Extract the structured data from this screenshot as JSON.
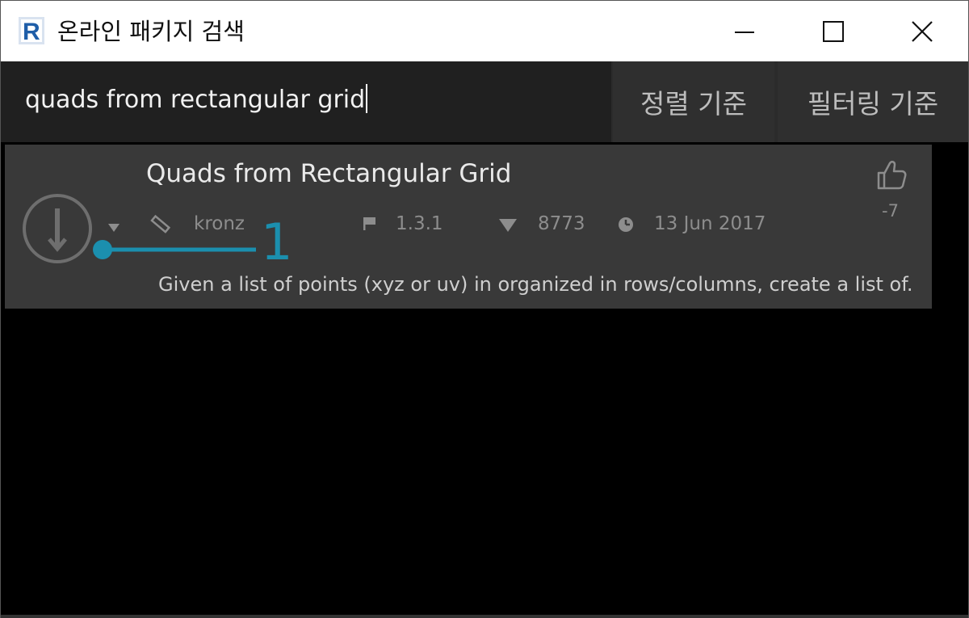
{
  "window": {
    "title": "온라인 패키지 검색",
    "logo_letter": "R",
    "logo_color": "#1f5ea8"
  },
  "search": {
    "value": "quads from rectangular grid",
    "sort_label": "정렬 기준",
    "filter_label": "필터링 기준"
  },
  "package": {
    "title": "Quads from Rectangular Grid",
    "author": "kronz",
    "version": "1.3.1",
    "downloads": "8773",
    "date": "13 Jun 2017",
    "votes": "-7",
    "description": "Given a list of points (xyz or uv) in organized in rows/columns, create a list of."
  },
  "callout": {
    "number": "1",
    "color": "#1b8fae"
  }
}
